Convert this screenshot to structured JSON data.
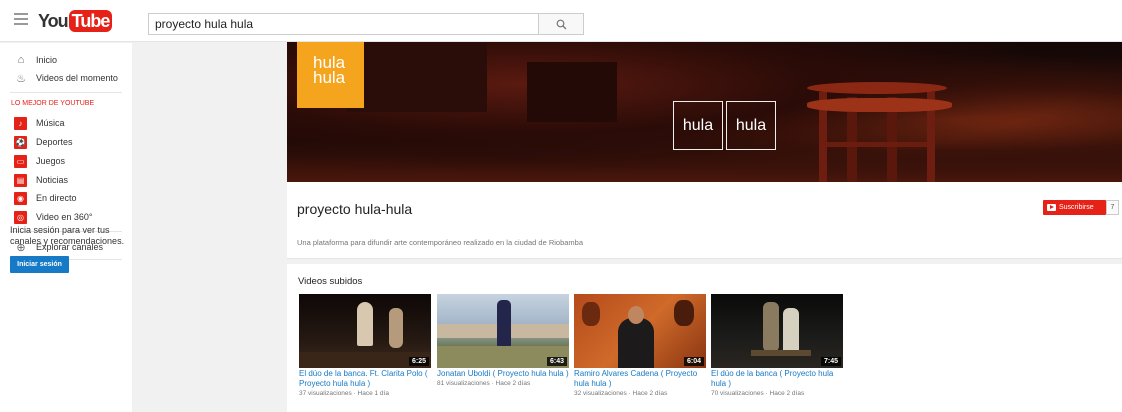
{
  "header": {
    "logo_you": "You",
    "logo_tube": "Tube",
    "search_value": "proyecto hula hula"
  },
  "sidebar": {
    "home": "Inicio",
    "trending": "Videos del momento",
    "best_of_heading": "LO MEJOR DE YOUTUBE",
    "items": [
      {
        "label": "Música",
        "icon": "music-icon"
      },
      {
        "label": "Deportes",
        "icon": "sports-icon"
      },
      {
        "label": "Juegos",
        "icon": "gaming-icon"
      },
      {
        "label": "Noticias",
        "icon": "news-icon"
      },
      {
        "label": "En directo",
        "icon": "live-icon"
      },
      {
        "label": "Video en 360°",
        "icon": "360-icon"
      }
    ],
    "browse_channels": "Explorar canales",
    "signin_prompt": "Inicia sesión para ver tus canales y recomendaciones.",
    "signin_button": "Iniciar sesión"
  },
  "channel": {
    "avatar_text_1": "hula",
    "avatar_text_2": "hula",
    "banner_word_1": "hula",
    "banner_word_2": "hula",
    "name": "proyecto hula-hula",
    "subscribe_label": "Suscribirse",
    "subscriber_count": "7",
    "description": "Una plataforma para difundir arte contemporáneo realizado en la ciudad de Riobamba"
  },
  "uploads": {
    "title": "Videos subidos",
    "videos": [
      {
        "title": "El dúo de la banca. Ft. Clarita Polo ( Proyecto hula hula )",
        "meta": "37 visualizaciones · Hace 1 día",
        "duration": "6:25"
      },
      {
        "title": "Jonatan Uboldi ( Proyecto hula hula )",
        "meta": "81 visualizaciones · Hace 2 días",
        "duration": "6:43"
      },
      {
        "title": "Ramiro Alvares Cadena ( Proyecto hula hula )",
        "meta": "32 visualizaciones · Hace 2 días",
        "duration": "6:04"
      },
      {
        "title": "El dúo de la banca ( Proyecto hula hula )",
        "meta": "70 visualizaciones · Hace 2 días",
        "duration": "7:45"
      }
    ]
  },
  "colors": {
    "brand_red": "#e62117",
    "link_blue": "#167ac6",
    "avatar_orange": "#f4a41d"
  }
}
